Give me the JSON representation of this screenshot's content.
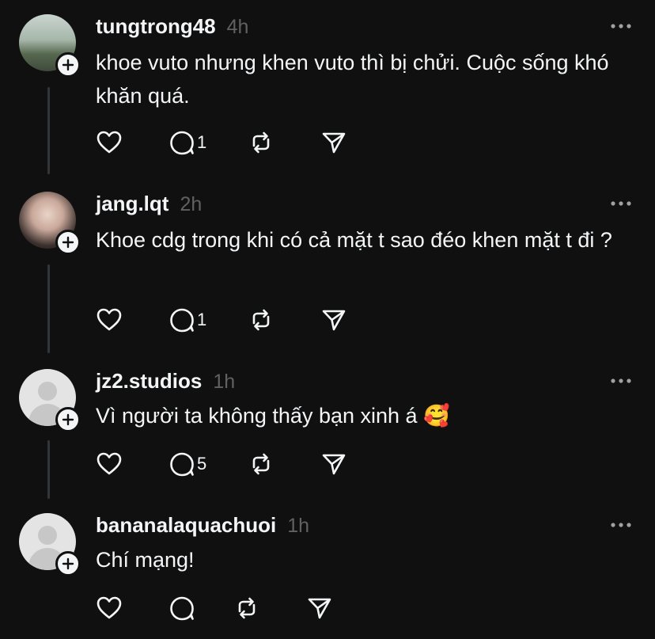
{
  "comments": [
    {
      "username": "tungtrong48",
      "time": "4h",
      "text": "khoe vuto nhưng khen vuto thì bị chửi. Cuộc sống khó khăn quá.",
      "reply_count": "1",
      "avatar": "landscape-photo"
    },
    {
      "username": "jang.lqt",
      "time": "2h",
      "text": "Khoe cdg trong khi có cả mặt t sao đéo khen mặt t đi ?",
      "reply_count": "1",
      "avatar": "portrait-photo"
    },
    {
      "username": "jz2.studios",
      "time": "1h",
      "text": "Vì người ta không thấy bạn xinh á 🥰",
      "reply_count": "5",
      "avatar": "default-placeholder"
    },
    {
      "username": "bananalaquachuoi",
      "time": "1h",
      "text": "Chí mạng!",
      "reply_count": "",
      "avatar": "default-placeholder"
    }
  ],
  "icons": {
    "like": "heart-icon",
    "reply": "comment-icon",
    "repost": "repost-icon",
    "share": "send-icon",
    "more": "more-icon",
    "follow": "plus-icon"
  },
  "colors": {
    "background": "#101010",
    "text": "#f3f5f7",
    "muted": "#616161",
    "thread_line": "#333638"
  }
}
